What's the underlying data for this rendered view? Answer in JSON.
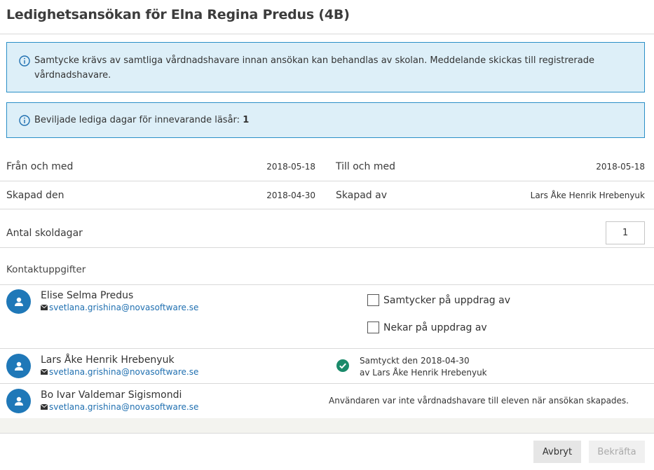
{
  "dialog": {
    "title": "Ledighetsansökan för Elna Regina Predus (4B)"
  },
  "notices": {
    "consent": "Samtycke krävs av samtliga vårdnadshavare innan ansökan kan behandlas av skolan. Meddelande skickas till registrerade vårdnadshavare.",
    "granted_label": "Beviljade lediga dagar för innevarande läsår:",
    "granted_value": "1"
  },
  "details": {
    "from_label": "Från och med",
    "from_value": "2018-05-18",
    "to_label": "Till och med",
    "to_value": "2018-05-18",
    "created_label": "Skapad den",
    "created_value": "2018-04-30",
    "created_by_label": "Skapad av",
    "created_by_value": "Lars Åke Henrik Hrebenyuk",
    "schooldays_label": "Antal skoldagar",
    "schooldays_value": "1"
  },
  "contacts": {
    "section_title": "Kontaktuppgifter",
    "items": [
      {
        "name": "Elise Selma Predus",
        "email": "svetlana.grishina@novasoftware.se",
        "consent_option": "Samtycker på uppdrag av",
        "deny_option": "Nekar på uppdrag av"
      },
      {
        "name": "Lars Åke Henrik Hrebenyuk",
        "email": "svetlana.grishina@novasoftware.se",
        "status_line1": "Samtyckt den 2018-04-30",
        "status_line2": "av Lars Åke Henrik Hrebenyuk"
      },
      {
        "name": "Bo Ivar Valdemar Sigismondi",
        "email": "svetlana.grishina@novasoftware.se",
        "note": "Användaren var inte vårdnadshavare till eleven när ansökan skapades."
      }
    ]
  },
  "footer": {
    "cancel_label": "Avbryt",
    "confirm_label": "Bekräfta"
  },
  "colors": {
    "accent": "#1f78b8",
    "info_bg": "#ddeff8",
    "info_border": "#2a8fc7",
    "success": "#1a8a6a"
  }
}
